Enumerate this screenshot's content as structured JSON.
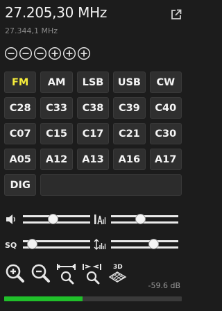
{
  "frequency": {
    "main": "27.205,30 MHz",
    "secondary": "27.344,1 MHz"
  },
  "icons": {
    "popout": "external-window-icon",
    "step_buttons": [
      "minus-circle-icon",
      "minus-circle-icon",
      "minus-circle-icon",
      "plus-circle-icon",
      "plus-circle-icon",
      "plus-circle-icon"
    ],
    "volume": "speaker-icon",
    "squelch": "squelch-icon",
    "agc": "agc-icon",
    "nr": "noise-reduction-icon",
    "tools": [
      "zoom-in-icon",
      "zoom-out-icon",
      "zoom-fit-icon",
      "zoom-center-icon",
      "3d-waterfall-icon"
    ]
  },
  "modes": [
    "FM",
    "AM",
    "LSB",
    "USB",
    "CW"
  ],
  "active_mode": "FM",
  "channels": [
    [
      "C28",
      "C33",
      "C38",
      "C39",
      "C40"
    ],
    [
      "C07",
      "C15",
      "C17",
      "C21",
      "C30"
    ],
    [
      "A05",
      "A12",
      "A13",
      "A16",
      "A17"
    ]
  ],
  "dig": {
    "label": "DIG",
    "display": ""
  },
  "sliders": {
    "volume": 0.45,
    "agc": 0.44,
    "squelch": 0.14,
    "nr": 0.63
  },
  "tools": {
    "badge_3d": "3D"
  },
  "signal": {
    "db_text": "-59.6 dB",
    "level": 0.44
  },
  "colors": {
    "background": "#1c1c1c",
    "button": "#2f2f2f",
    "active_mode": "#f6ec3a",
    "meter": "#20c02a"
  }
}
